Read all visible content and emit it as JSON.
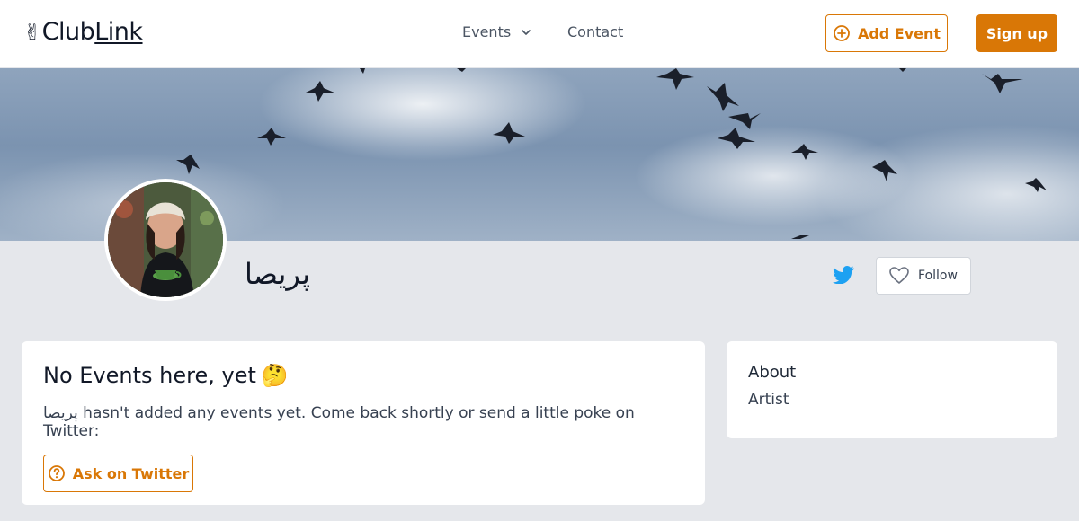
{
  "header": {
    "logo_emoji": "✌",
    "logo_club": "Club",
    "logo_link": "Link",
    "nav_events": "Events",
    "nav_contact": "Contact",
    "add_event_label": "Add Event",
    "signup_label": "Sign up"
  },
  "profile": {
    "name": "پریصا",
    "follow_label": "Follow"
  },
  "events_card": {
    "title": "No Events here, yet",
    "title_emoji": "🤔",
    "user_name": "پریصا",
    "message": " hasn't added any events yet. Come back shortly or send a little poke on Twitter:",
    "ask_label": "Ask on Twitter"
  },
  "about_card": {
    "title": "About",
    "role": "Artist"
  },
  "icons": {
    "chevron": "chevron-down-icon",
    "add": "plus-circle-icon",
    "twitter": "twitter-icon",
    "follow": "heart-icon",
    "ask": "question-circle-icon"
  },
  "colors": {
    "accent": "#d97706",
    "twitter": "#1da1f2",
    "background": "#e5e7eb"
  }
}
